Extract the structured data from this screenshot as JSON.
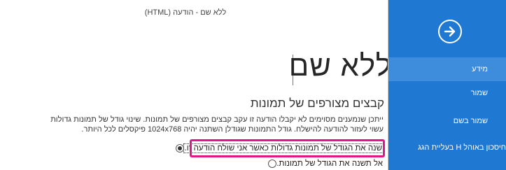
{
  "document": {
    "title": "ללא שם - הודעה (HTML)"
  },
  "main": {
    "page_title": "ללא שם",
    "section_heading": "קבצים מצורפים של תמונות",
    "description": "ייתכן שנמענים מסוימים לא יקבלו הודעה זו עקב קבצים מצורפים של תמונות. שינוי גודל של תמונות גדולות עשוי לעזור להודעה להישלח. גודל התמונות שגודלן השתנה יהיה 1024x768 פיקסלים לכל היותר.",
    "options": [
      {
        "label": "שנה את הגודל של תמונות גדולות כאשר אני שולח הודעה זו.",
        "selected": true
      },
      {
        "label": "אל תשנה את הגודל של תמונות.",
        "selected": false
      }
    ]
  },
  "sidebar": {
    "back_icon": "arrow-right-icon",
    "items": [
      {
        "label": "מידע",
        "active": true
      },
      {
        "label": "שמור",
        "active": false
      },
      {
        "label": "שמור בשם",
        "active": false
      },
      {
        "label": "חיסכון באוהל H בעליית הגג",
        "active": false
      }
    ]
  },
  "colors": {
    "sidebar": "#1f78d1",
    "sidebar_active": "#3e8ddd",
    "highlight": "#e3158b"
  }
}
